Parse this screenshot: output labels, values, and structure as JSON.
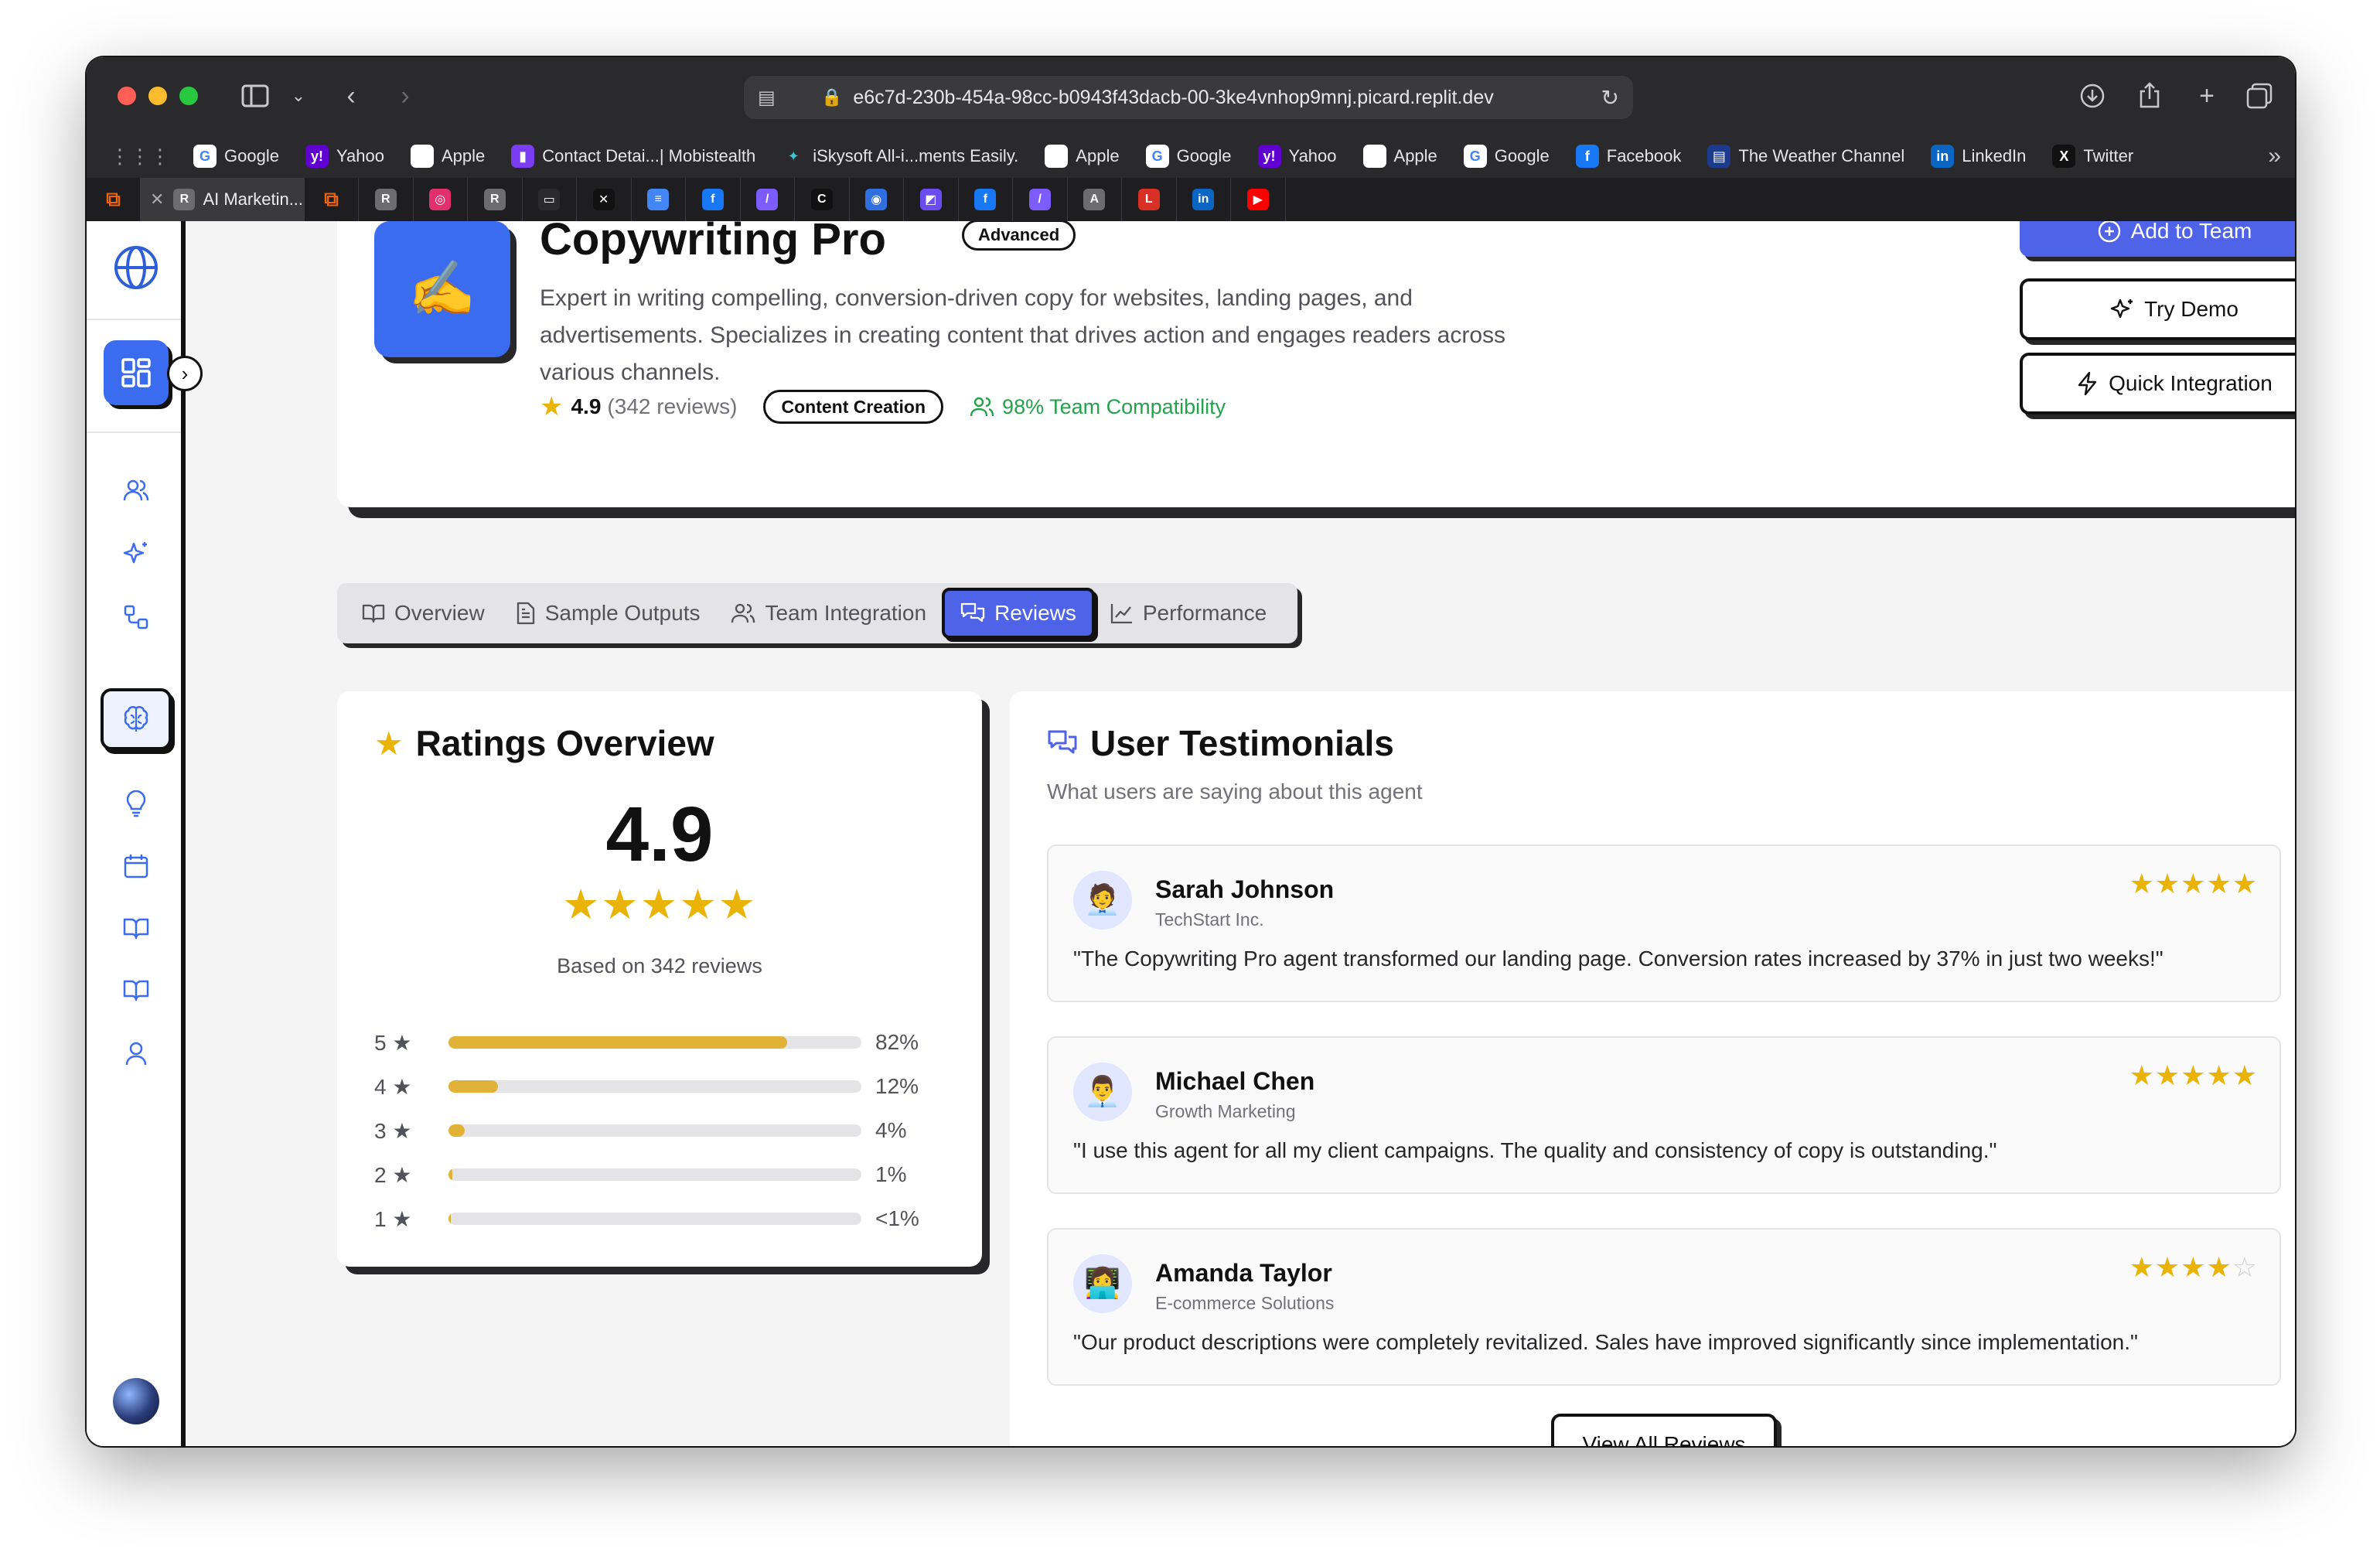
{
  "browser": {
    "url": "e6c7d-230b-454a-98cc-b0943f43dacb-00-3ke4vnhop9mnj.picard.replit.dev",
    "bookmarks": [
      {
        "label": "Google",
        "color": "#ffffff",
        "glyph": "G",
        "fg": "#4285f4"
      },
      {
        "label": "Yahoo",
        "color": "#6001d2",
        "glyph": "y!",
        "fg": "#ffffff"
      },
      {
        "label": "Apple",
        "color": "#ffffff",
        "glyph": "",
        "fg": "#111111"
      },
      {
        "label": "Contact Detai...| Mobistealth",
        "color": "#7a3cf0",
        "glyph": "▮",
        "fg": "#ffffff"
      },
      {
        "label": "iSkysoft All-i...ments Easily.",
        "color": "#2a2a2c",
        "glyph": "✦",
        "fg": "#3ec1d3"
      },
      {
        "label": "Apple",
        "color": "#ffffff",
        "glyph": "",
        "fg": "#111111"
      },
      {
        "label": "Google",
        "color": "#ffffff",
        "glyph": "G",
        "fg": "#4285f4"
      },
      {
        "label": "Yahoo",
        "color": "#6001d2",
        "glyph": "y!",
        "fg": "#ffffff"
      },
      {
        "label": "Apple",
        "color": "#ffffff",
        "glyph": "",
        "fg": "#111111"
      },
      {
        "label": "Google",
        "color": "#ffffff",
        "glyph": "G",
        "fg": "#4285f4"
      },
      {
        "label": "Facebook",
        "color": "#1877f2",
        "glyph": "f",
        "fg": "#ffffff"
      },
      {
        "label": "The Weather Channel",
        "color": "#1c3b8c",
        "glyph": "▤",
        "fg": "#ffffff"
      },
      {
        "label": "LinkedIn",
        "color": "#0a66c2",
        "glyph": "in",
        "fg": "#ffffff"
      },
      {
        "label": "Twitter",
        "color": "#111111",
        "glyph": "X",
        "fg": "#ffffff"
      }
    ],
    "active_tab_label": "AI Marketin...",
    "tab_favicons": [
      {
        "glyph": "R",
        "color": "#6b6b70"
      },
      {
        "glyph": "◎",
        "color": "#e1306c"
      },
      {
        "glyph": "R",
        "color": "#6b6b70"
      },
      {
        "glyph": "▭",
        "color": "#2a2a2c"
      },
      {
        "glyph": "✕",
        "color": "#111111"
      },
      {
        "glyph": "≡",
        "color": "#4285f4"
      },
      {
        "glyph": "f",
        "color": "#1877f2"
      },
      {
        "glyph": "/",
        "color": "#7c5cff"
      },
      {
        "glyph": "C",
        "color": "#111111"
      },
      {
        "glyph": "◉",
        "color": "#2f6fe0"
      },
      {
        "glyph": "◩",
        "color": "#6b4cf0"
      },
      {
        "glyph": "f",
        "color": "#1877f2"
      },
      {
        "glyph": "/",
        "color": "#7c5cff"
      },
      {
        "glyph": "A",
        "color": "#6b6b70"
      },
      {
        "glyph": "L",
        "color": "#d93025"
      },
      {
        "glyph": "in",
        "color": "#0a66c2"
      },
      {
        "glyph": "▶",
        "color": "#ff0000"
      }
    ]
  },
  "agent": {
    "name": "Copywriting Pro",
    "level": "Advanced",
    "description": "Expert in writing compelling, conversion-driven copy for websites, landing pages, and advertisements. Specializes in creating content that drives action and engages readers across various channels.",
    "rating": "4.9",
    "reviews_text": "(342 reviews)",
    "category": "Content Creation",
    "compatibility": "98% Team Compatibility",
    "icon_emoji": "✍️"
  },
  "actions": {
    "add_to_team": "Add to Team",
    "try_demo": "Try Demo",
    "quick_integration": "Quick Integration"
  },
  "tabs": [
    {
      "label": "Overview",
      "active": false
    },
    {
      "label": "Sample Outputs",
      "active": false
    },
    {
      "label": "Team Integration",
      "active": false
    },
    {
      "label": "Reviews",
      "active": true
    },
    {
      "label": "Performance",
      "active": false
    }
  ],
  "ratings": {
    "title": "Ratings Overview",
    "score": "4.9",
    "stars": "★★★★★",
    "based_on": "Based on 342 reviews",
    "breakdown": [
      {
        "stars": "5",
        "percent_label": "82%",
        "fill": 0.82
      },
      {
        "stars": "4",
        "percent_label": "12%",
        "fill": 0.12
      },
      {
        "stars": "3",
        "percent_label": "4%",
        "fill": 0.04
      },
      {
        "stars": "2",
        "percent_label": "1%",
        "fill": 0.01
      },
      {
        "stars": "1",
        "percent_label": "<1%",
        "fill": 0.005
      }
    ]
  },
  "testimonials": {
    "title": "User Testimonials",
    "subtitle": "What users are saying about this agent",
    "items": [
      {
        "name": "Sarah Johnson",
        "org": "TechStart Inc.",
        "avatar": "🧑‍💼",
        "rating": 5,
        "quote": "\"The Copywriting Pro agent transformed our landing page. Conversion rates increased by 37% in just two weeks!\""
      },
      {
        "name": "Michael Chen",
        "org": "Growth Marketing",
        "avatar": "👨‍💼",
        "rating": 5,
        "quote": "\"I use this agent for all my client campaigns. The quality and consistency of copy is outstanding.\""
      },
      {
        "name": "Amanda Taylor",
        "org": "E-commerce Solutions",
        "avatar": "👩‍💻",
        "rating": 4,
        "quote": "\"Our product descriptions were completely revitalized. Sales have improved significantly since implementation.\""
      }
    ],
    "view_all": "View All Reviews"
  },
  "colors": {
    "accent": "#4f63e8",
    "brand_blue": "#3b6cf0",
    "star": "#eab308",
    "bar_fill": "#e2b237",
    "success": "#22a34a"
  }
}
